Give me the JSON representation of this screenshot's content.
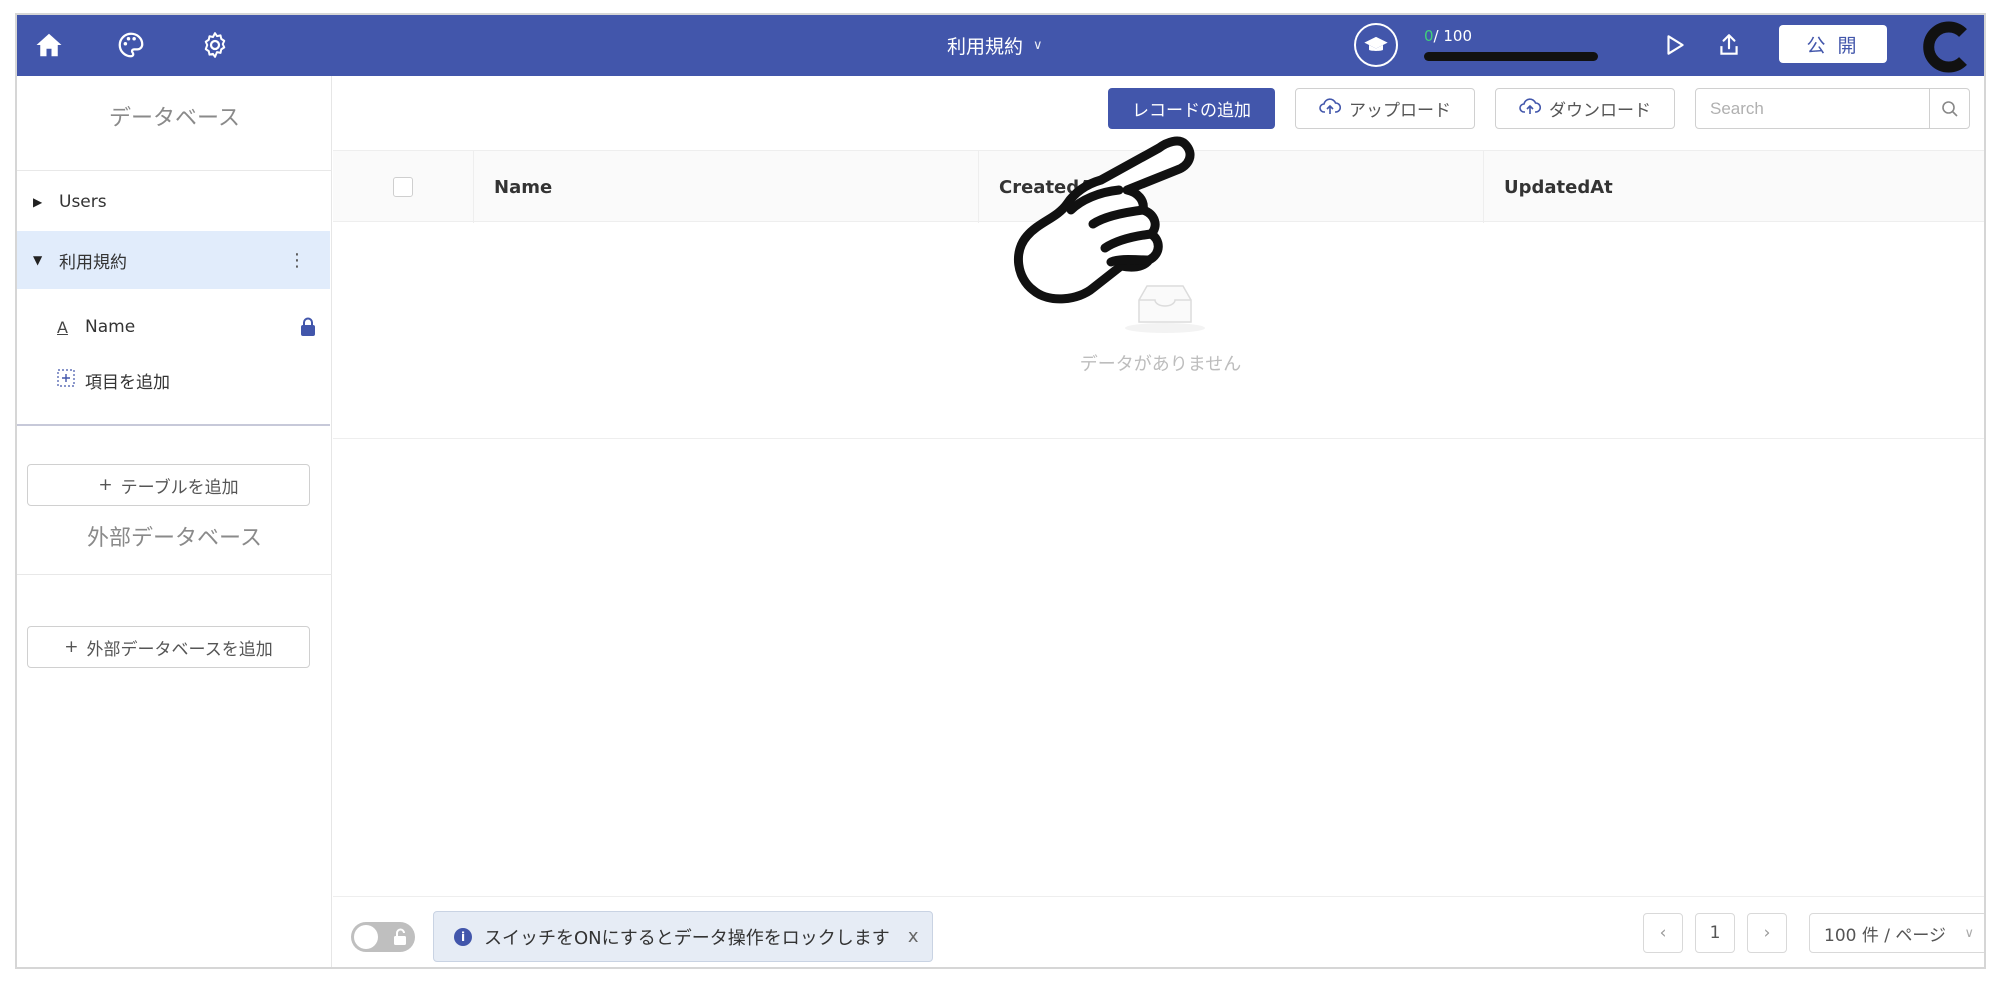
{
  "header": {
    "title": "利用規約",
    "progress_current": "0",
    "progress_total": "/ 100",
    "progress_fraction": 0,
    "publish_label": "公 開"
  },
  "sidebar": {
    "database_title": "データベース",
    "tables": [
      {
        "label": "Users",
        "expanded": false
      },
      {
        "label": "利用規約",
        "expanded": true
      }
    ],
    "fields": [
      {
        "label": "Name"
      },
      {
        "label": "項目を追加"
      }
    ],
    "add_table_label": "テーブルを追加",
    "external_title": "外部データベース",
    "add_external_label": "外部データベースを追加"
  },
  "toolbar": {
    "add_record_label": "レコードの追加",
    "upload_label": "アップロード",
    "download_label": "ダウンロード",
    "search_placeholder": "Search"
  },
  "table": {
    "columns": [
      "Name",
      "CreatedAt",
      "UpdatedAt"
    ],
    "empty_text": "データがありません"
  },
  "footer": {
    "notice_text": "スイッチをONにするとデータ操作をロックします",
    "close_glyph": "x",
    "current_page": "1",
    "page_size_label": "100 件 / ページ"
  },
  "colors": {
    "accent": "#4256ab",
    "progress": "#3fd17a",
    "active_row": "#e1ecfb"
  }
}
